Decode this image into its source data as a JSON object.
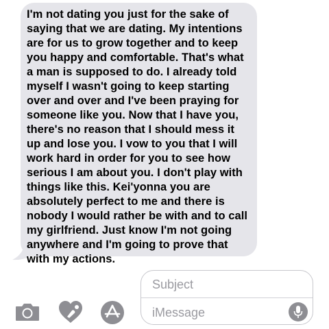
{
  "message": {
    "lines": [
      "I'm not dating you just for the sake of",
      "saying that we are dating. My intentions",
      "are for us to grow together and to keep",
      "you happy and comfortable. That's what",
      "a man is supposed to do. I already told",
      "myself I wasn't going to keep starting",
      "over and over and I've been praying for",
      "someone like you. Now that I have you,",
      "there's no reason that I should mess it",
      "up and lose you. I vow to you that I will",
      "work hard in order for you to see how",
      "serious I am about you. I don't play with",
      "things like this. Kei'yonna you are",
      "absolutely perfect to me and there is",
      "nobody I would rather be with and to call",
      "my girlfriend. Just know I'm not going",
      "anywhere and I'm going to prove that",
      "with my actions."
    ]
  },
  "composer": {
    "subject_placeholder": "Subject",
    "message_placeholder": "iMessage"
  },
  "toolbar": {
    "camera_icon": "camera-icon",
    "digital_touch_icon": "digital-touch-icon",
    "app_store_icon": "app-store-icon",
    "mic_icon": "microphone-icon"
  },
  "colors": {
    "bubble": "#e5e5ea",
    "icon_gray": "#8e8e93",
    "placeholder": "#9a9aa0",
    "border": "#c7c7cc"
  }
}
